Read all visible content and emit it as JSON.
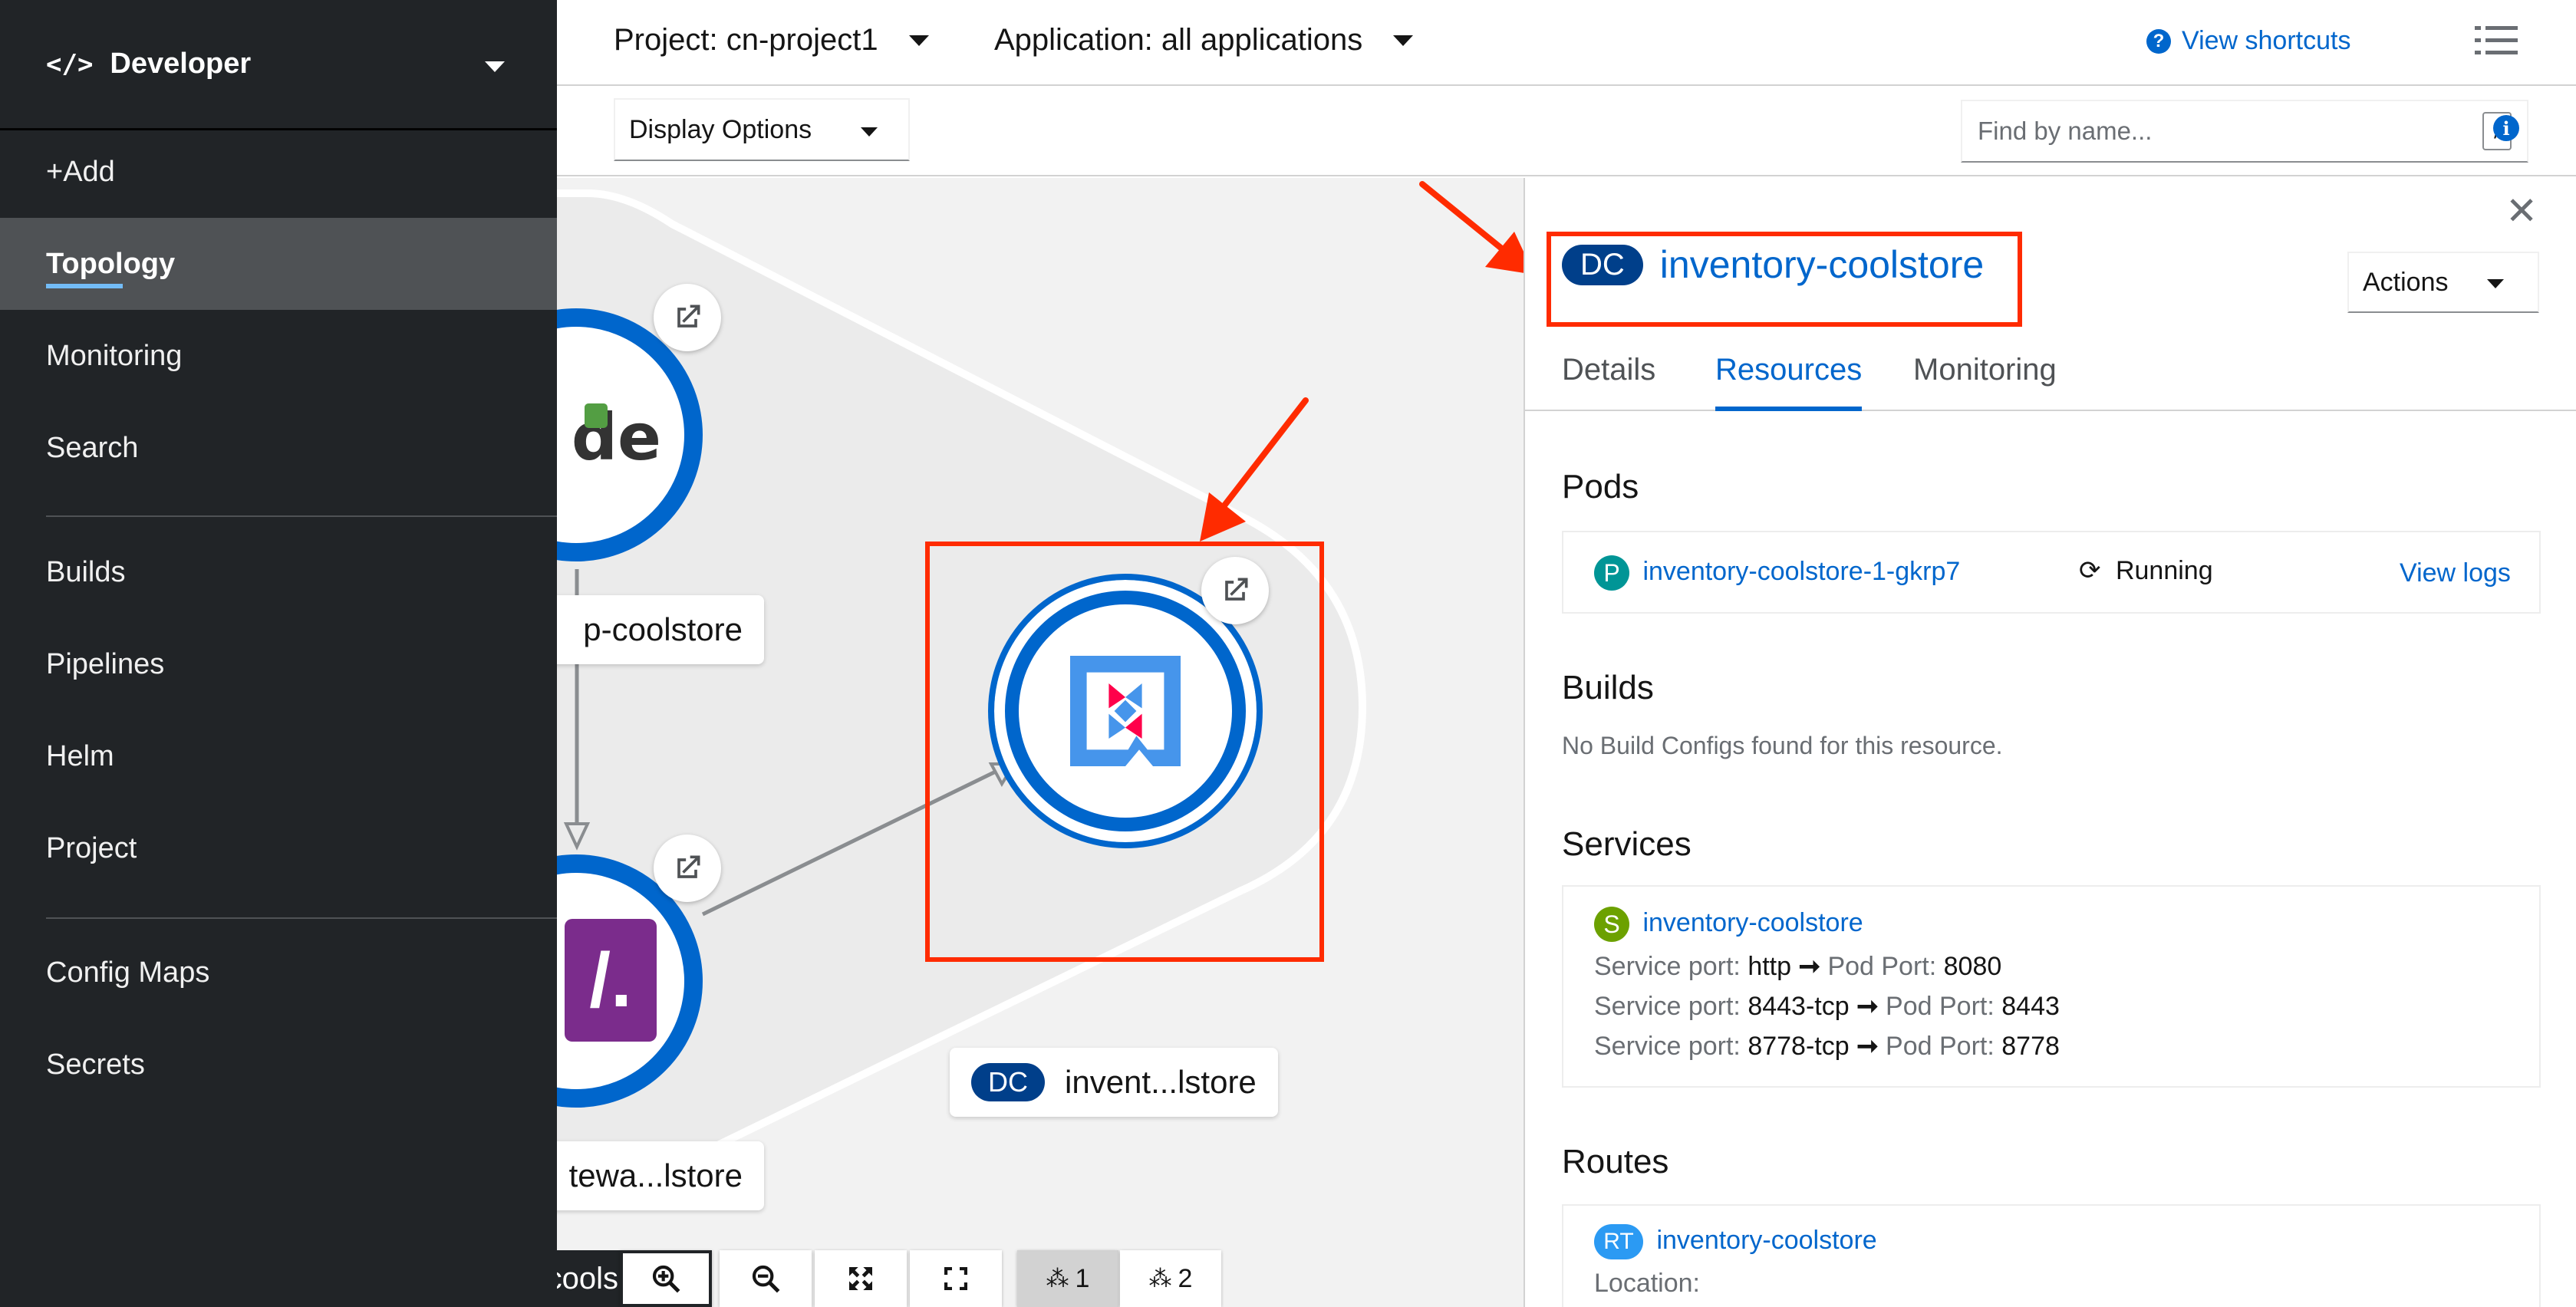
{
  "sidebar": {
    "perspective": "Developer",
    "items": [
      {
        "label": "+Add"
      },
      {
        "label": "Topology"
      },
      {
        "label": "Monitoring"
      },
      {
        "label": "Search"
      },
      {
        "label": "Builds"
      },
      {
        "label": "Pipelines"
      },
      {
        "label": "Helm"
      },
      {
        "label": "Project"
      },
      {
        "label": "Config Maps"
      },
      {
        "label": "Secrets"
      }
    ]
  },
  "topbar": {
    "project": "Project: cn-project1",
    "application": "Application: all applications",
    "shortcuts": "View shortcuts"
  },
  "toolbar": {
    "display_options": "Display Options",
    "find_placeholder": "Find by name...",
    "find_shortcut": "/"
  },
  "topology": {
    "nodes": [
      {
        "label": "p-coolstore"
      },
      {
        "label": "tewa...lstore"
      },
      {
        "badge": "DC",
        "label": "invent...lstore"
      }
    ],
    "partial_label": "cools",
    "layout_buttons": [
      "1",
      "2"
    ]
  },
  "panel": {
    "badge": "DC",
    "title": "inventory-coolstore",
    "actions": "Actions",
    "tabs": [
      "Details",
      "Resources",
      "Monitoring"
    ],
    "pods": {
      "heading": "Pods",
      "badge": "P",
      "name": "inventory-coolstore-1-gkrp7",
      "status": "Running",
      "logs": "View logs"
    },
    "builds": {
      "heading": "Builds",
      "empty": "No Build Configs found for this resource."
    },
    "services": {
      "heading": "Services",
      "badge": "S",
      "name": "inventory-coolstore",
      "service_port_label": "Service port:",
      "pod_port_label": "Pod Port:",
      "ports": [
        {
          "service": "http",
          "pod": "8080"
        },
        {
          "service": "8443-tcp",
          "pod": "8443"
        },
        {
          "service": "8778-tcp",
          "pod": "8778"
        }
      ]
    },
    "routes": {
      "heading": "Routes",
      "badge": "RT",
      "name": "inventory-coolstore",
      "location_label": "Location:"
    }
  },
  "colors": {
    "accent": "#0066cc",
    "annotation": "#ff2b00",
    "sidebar_bg": "#212427"
  }
}
